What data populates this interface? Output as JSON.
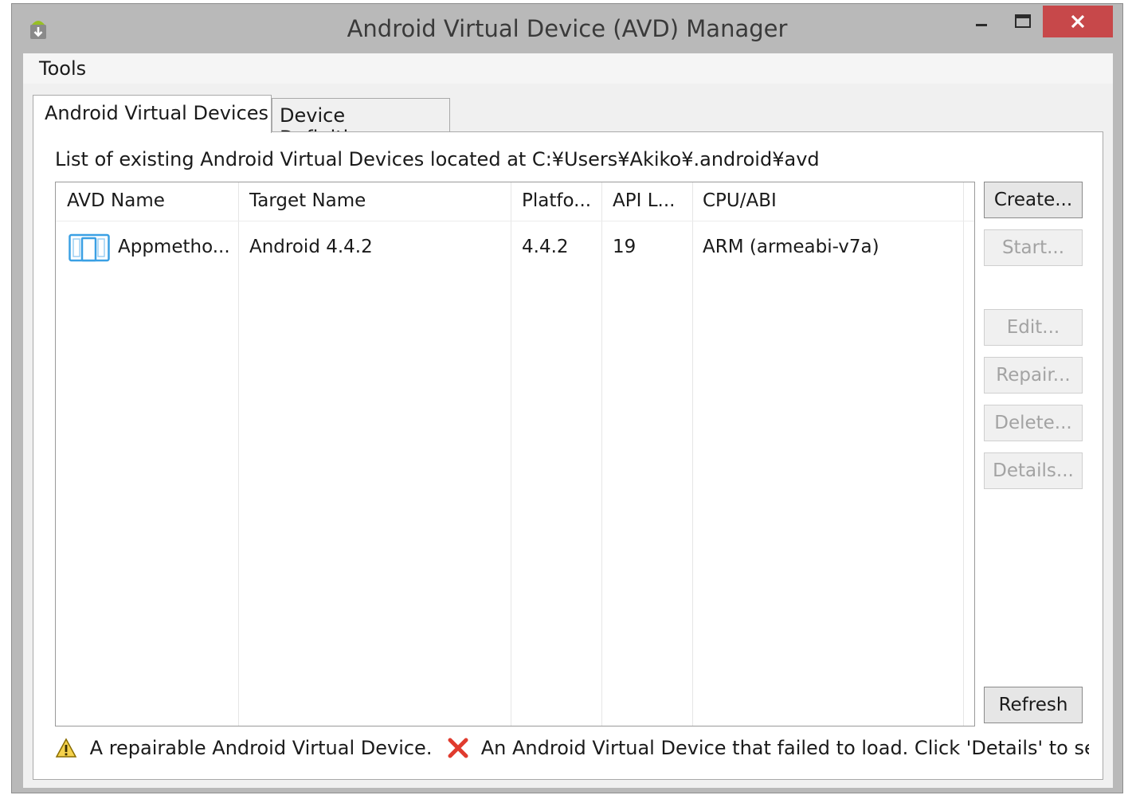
{
  "window": {
    "title": "Android Virtual Device (AVD) Manager",
    "close_color": "#c7484a"
  },
  "menu": {
    "tools_label": "Tools"
  },
  "tabs": [
    {
      "label": "Android Virtual Devices",
      "active": true
    },
    {
      "label": "Device Definitions",
      "active": false
    }
  ],
  "panel": {
    "description": "List of existing Android Virtual Devices located at C:¥Users¥Akiko¥.android¥avd"
  },
  "table": {
    "columns": [
      "AVD Name",
      "Target Name",
      "Platfo...",
      "API L...",
      "CPU/ABI"
    ],
    "rows": [
      {
        "icon": "device-icon",
        "avd_name": "Appmetho...",
        "target_name": "Android 4.4.2",
        "platform": "4.4.2",
        "api_level": "19",
        "cpu_abi": "ARM (armeabi-v7a)"
      }
    ]
  },
  "buttons": {
    "create": "Create...",
    "start": "Start...",
    "edit": "Edit...",
    "repair": "Repair...",
    "delete": "Delete...",
    "details": "Details...",
    "refresh": "Refresh"
  },
  "legend": {
    "repairable": "A repairable Android Virtual Device.",
    "failed": "An Android Virtual Device that failed to load. Click 'Details' to see the error."
  }
}
